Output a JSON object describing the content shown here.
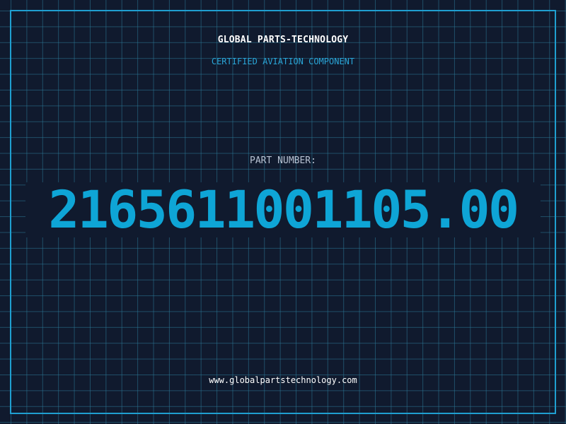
{
  "header": {
    "company_name": "GLOBAL PARTS-TECHNOLOGY",
    "certification": "CERTIFIED AVIATION COMPONENT"
  },
  "part": {
    "label": "PART NUMBER:",
    "number": "2165611001105.00"
  },
  "footer": {
    "website": "www.globalpartstechnology.com"
  },
  "colors": {
    "background": "#101a2e",
    "grid": "#2b7896",
    "frame": "#1f9fd0",
    "accent": "#0ea5d6",
    "label": "#b8c2d2",
    "text": "#ffffff"
  }
}
